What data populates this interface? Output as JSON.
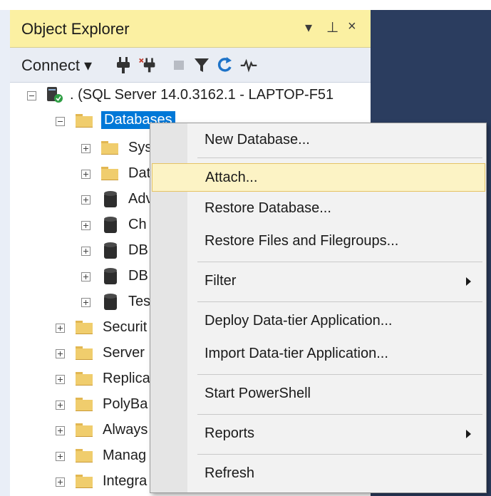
{
  "panel": {
    "title": "Object Explorer",
    "controls": {
      "dropdown": "▾",
      "pin": "⊥",
      "close": "×"
    }
  },
  "toolbar": {
    "connect_label": "Connect ▾",
    "icons": [
      "connect-object-explorer-icon",
      "disconnect-icon",
      "stop-icon",
      "filter-icon",
      "refresh-icon",
      "activity-monitor-icon"
    ]
  },
  "tree": {
    "server": ". (SQL Server 14.0.3162.1 - LAPTOP-F51",
    "databases": "Databases",
    "db_children": [
      "Sys",
      "Dat",
      "Adv",
      "Ch",
      "DB",
      "DB",
      "Tes"
    ],
    "server_nodes": [
      "Securit",
      "Server",
      "Replica",
      "PolyBa",
      "Always",
      "Manag",
      "Integra"
    ]
  },
  "context_menu": {
    "items": [
      {
        "label": "New Database..."
      },
      {
        "label": "Attach..."
      },
      {
        "label": "Restore Database..."
      },
      {
        "label": "Restore Files and Filegroups..."
      },
      {
        "label": "Filter"
      },
      {
        "label": "Deploy Data-tier Application..."
      },
      {
        "label": "Import Data-tier Application..."
      },
      {
        "label": "Start PowerShell"
      },
      {
        "label": "Reports"
      },
      {
        "label": "Refresh"
      }
    ]
  },
  "colors": {
    "title_bar": "#fbf0a2",
    "selection": "#0078d7",
    "menu_highlight": "#fcf3c5",
    "background": "#2b3d5f"
  }
}
